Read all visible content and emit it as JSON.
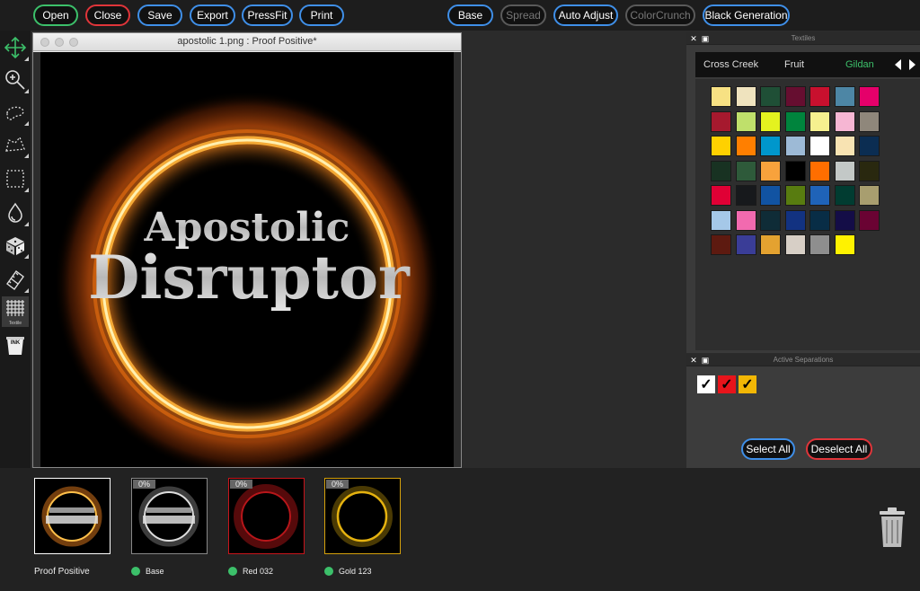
{
  "toolbar": {
    "buttons": [
      {
        "label": "Open",
        "style": "green"
      },
      {
        "label": "Close",
        "style": "red"
      },
      {
        "label": "Save",
        "style": "blue"
      },
      {
        "label": "Export",
        "style": "blue"
      },
      {
        "label": "PressFit",
        "style": "blue"
      },
      {
        "label": "Print",
        "style": "blue"
      },
      {
        "label": "Base",
        "style": "blue"
      },
      {
        "label": "Spread",
        "style": "dim"
      },
      {
        "label": "Auto Adjust",
        "style": "blue"
      },
      {
        "label": "ColorCrunch",
        "style": "dim"
      },
      {
        "label": "Black Generation",
        "style": "blue"
      }
    ]
  },
  "tools": {
    "items": [
      "move-tool",
      "zoom-tool",
      "lasso-tool",
      "polygon-lasso-tool",
      "marquee-tool",
      "dropper-tool",
      "dice-tool",
      "eraser-tool",
      "textile-tool",
      "ink-tool"
    ],
    "textile_label": "Textile",
    "ink_label": "INK"
  },
  "document": {
    "title": "apostolic 1.png : Proof Positive*",
    "art_line1": "Apostolic",
    "art_line2": "Disruptor"
  },
  "textiles_panel": {
    "title": "Textiles",
    "tabs": [
      "Cross Creek",
      "Fruit",
      "Gildan"
    ],
    "active_tab": "Gildan",
    "swatches": [
      [
        "#f7e183",
        "#efe3be",
        "#1f4f36",
        "#660e30",
        "#c8102e",
        "#4d86a5",
        "#e5006a"
      ],
      [
        "#a6192e",
        "#bfe06b",
        "#e4f21f",
        "#00843d",
        "#f6f08f",
        "#f6b6d3",
        "#8f877b"
      ],
      [
        "#ffd100",
        "#ff7f00",
        "#0097cc",
        "#9dbad6",
        "#ffffff",
        "#f8e3b2",
        "#0b2d52"
      ],
      [
        "#183222",
        "#2e5a3a",
        "#f8a23c",
        "#000000",
        "#ff6e00",
        "#c3c8c7",
        "#29280f"
      ],
      [
        "#e00035",
        "#17191c",
        "#1153a2",
        "#587c10",
        "#1f63b8",
        "#013c31",
        "#a89e6f"
      ],
      [
        "#a5c8e8",
        "#f26aaf",
        "#0f2c37",
        "#123281",
        "#082d46",
        "#140d47",
        "#6a0333"
      ],
      [
        "#5d1a10",
        "#3a3d97",
        "#e4a230",
        "#d7cfc6",
        "#8e8e8e",
        "#fff200"
      ]
    ]
  },
  "separations_panel": {
    "title": "Active Separations",
    "checks": [
      {
        "color": "#ffffff"
      },
      {
        "color": "#e8141b"
      },
      {
        "color": "#f2b705"
      }
    ],
    "select_all": "Select All",
    "deselect_all": "Deselect All"
  },
  "thumbnails": [
    {
      "label": "Proof Positive",
      "pct": "",
      "border": "#ffffff",
      "dot": false
    },
    {
      "label": "Base",
      "pct": "0%",
      "border": "#888888",
      "dot": true
    },
    {
      "label": "Red 032",
      "pct": "0%",
      "border": "#c8141b",
      "dot": true
    },
    {
      "label": "Gold 123",
      "pct": "0%",
      "border": "#d6a10c",
      "dot": true
    }
  ]
}
